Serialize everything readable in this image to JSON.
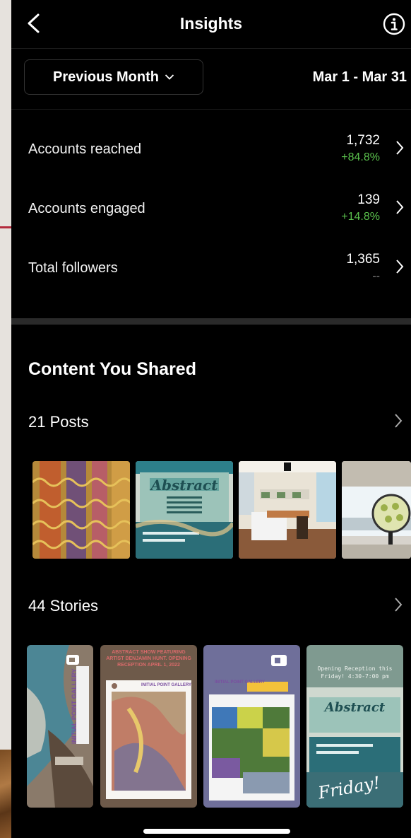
{
  "header": {
    "title": "Insights",
    "back_icon": "chevron-left-icon",
    "info_icon": "info-icon"
  },
  "filter": {
    "period_label": "Previous Month",
    "date_range": "Mar 1 - Mar 31"
  },
  "metrics": [
    {
      "label": "Accounts reached",
      "value": "1,732",
      "change": "+84.8%"
    },
    {
      "label": "Accounts engaged",
      "value": "139",
      "change": "+14.8%"
    },
    {
      "label": "Total followers",
      "value": "1,365",
      "change": "--"
    }
  ],
  "content": {
    "title": "Content You Shared",
    "posts_label": "21 Posts",
    "stories_label": "44 Stories",
    "posts": [
      {
        "kind": "painting"
      },
      {
        "kind": "flyer",
        "heading": "Abstract"
      },
      {
        "kind": "gallery-room"
      },
      {
        "kind": "gallery-window"
      }
    ],
    "stories": [
      {
        "kind": "painting",
        "sticker": "INITIAL POINT GALLERY"
      },
      {
        "kind": "repost",
        "heading": "ABSTRACT SHOW FEATURING ARTIST BENJAMIN HUNT. OPENING RECEPTION APRIL 1, 2022",
        "sticker": "INITIAL POINT GALLERY"
      },
      {
        "kind": "repost",
        "sticker": "INITIAL POINT GALLERY"
      },
      {
        "kind": "flyer",
        "heading": "Opening Reception this Friday! 4:30-7:00 pm",
        "flyer_title": "Abstract",
        "note": "Friday!"
      }
    ]
  },
  "colors": {
    "positive": "#5bc24d",
    "background": "#000000",
    "divider": "#2a2a2a"
  }
}
